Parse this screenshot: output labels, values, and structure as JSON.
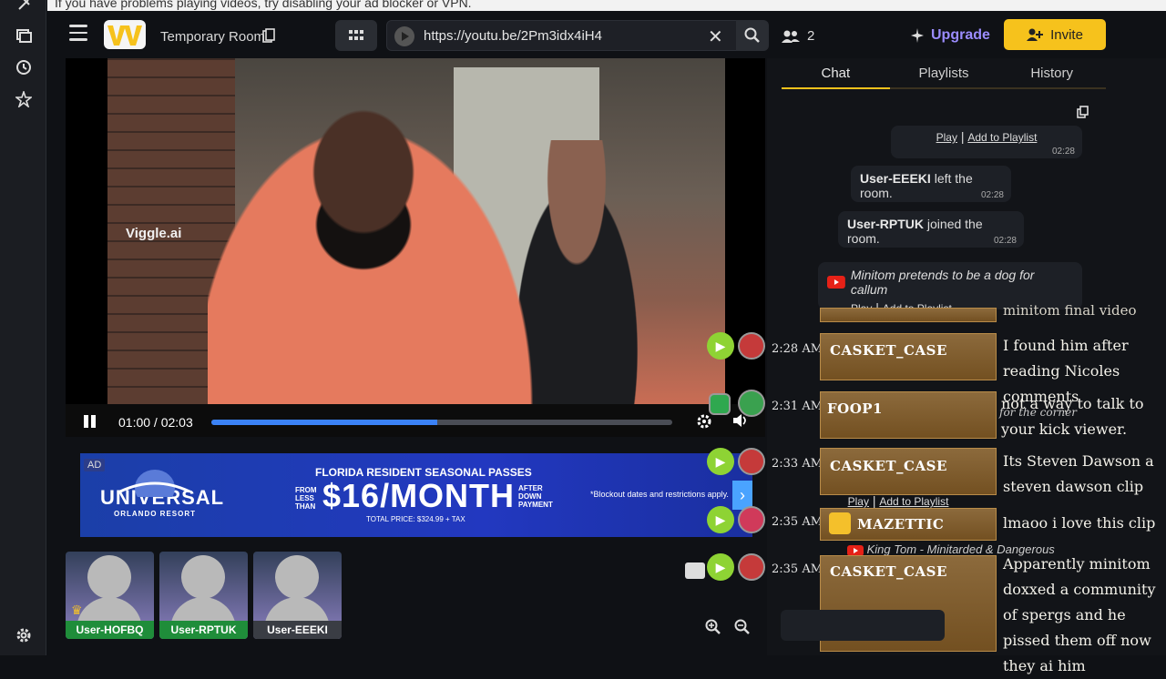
{
  "notice": "If you have problems playing videos, try disabling your ad blocker or VPN.",
  "header": {
    "room_name": "Temporary Room",
    "url": "https://youtu.be/2Pm3idx4iH4",
    "user_count": "2",
    "upgrade_label": "Upgrade",
    "invite_label": "Invite"
  },
  "player": {
    "watermark": "Viggle.ai",
    "time": "01:00 / 02:03",
    "progress_fraction": 0.49
  },
  "ad": {
    "tag": "AD",
    "brand": "UNIVERSAL",
    "brand_sub": "ORLANDO RESORT",
    "headline": "FLORIDA RESIDENT SEASONAL PASSES",
    "from_text": "FROM LESS THAN",
    "price": "$16/MONTH",
    "after_text": "AFTER DOWN PAYMENT",
    "total": "TOTAL PRICE: $324.99 + TAX",
    "note": "*Blockout dates and restrictions apply."
  },
  "participants": [
    {
      "name": "User-HOFBQ",
      "color": "green"
    },
    {
      "name": "User-RPTUK",
      "color": "green"
    },
    {
      "name": "User-EEEKI",
      "color": "gray"
    }
  ],
  "chat": {
    "tabs": [
      "Chat",
      "Playlists",
      "History"
    ],
    "play_link": "Play",
    "add_link": "Add to Playlist",
    "messages": [
      {
        "time": "02:28"
      },
      {
        "user": "User-EEEKI",
        "text": "left the room.",
        "time": "02:28"
      },
      {
        "user": "User-RPTUK",
        "text": "joined the room.",
        "time": "02:28"
      },
      {
        "title": "Minitom pretends to be a dog for callum"
      }
    ]
  },
  "overlay": {
    "lines": [
      {
        "time": "2:28 AM",
        "name": "CASKET_CASE",
        "text": "I found him after reading Nicoles comments"
      },
      {
        "time": "2:31 AM",
        "name": "FOOP1",
        "text": "not a way to talk to your kick viewer."
      },
      {
        "time": "2:33 AM",
        "name": "CASKET_CASE",
        "text": "Its Steven Dawson a steven dawson clip"
      },
      {
        "time": "2:35 AM",
        "name": "MAZETTIC",
        "text": "lmaoo i love this clip"
      },
      {
        "time": "2:35 AM",
        "name": "CASKET_CASE",
        "text": "Apparently minitom doxxed a community of spergs and he pissed them off now they ai him"
      }
    ],
    "top_text": "minitom final video",
    "ghost": [
      {
        "text": "for the corner"
      },
      {
        "text": "King Tom - Minitarded & Dangerous"
      }
    ]
  }
}
